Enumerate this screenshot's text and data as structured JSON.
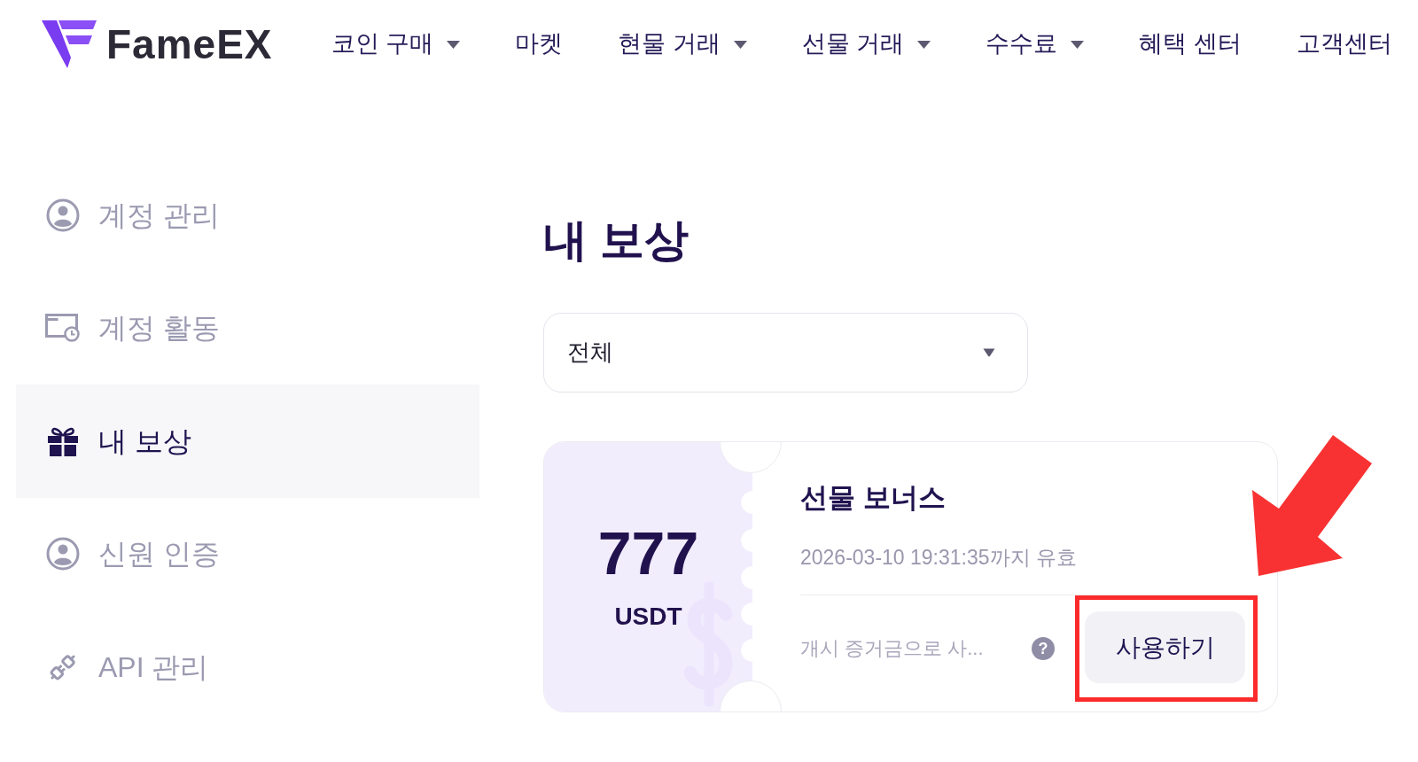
{
  "header": {
    "logo": "FameEX",
    "nav": [
      {
        "label": "코인 구매",
        "dropdown": true
      },
      {
        "label": "마켓",
        "dropdown": false
      },
      {
        "label": "현물 거래",
        "dropdown": true
      },
      {
        "label": "선물 거래",
        "dropdown": true
      },
      {
        "label": "수수료",
        "dropdown": true
      },
      {
        "label": "혜택 센터",
        "dropdown": false
      },
      {
        "label": "고객센터",
        "dropdown": false
      }
    ]
  },
  "sidebar": {
    "items": [
      {
        "label": "계정 관리",
        "selected": false
      },
      {
        "label": "계정 활동",
        "selected": false
      },
      {
        "label": "내 보상",
        "selected": true
      },
      {
        "label": "신원 인증",
        "selected": false
      },
      {
        "label": "API 관리",
        "selected": false
      }
    ]
  },
  "main": {
    "title": "내 보상",
    "filter": {
      "value": "전체"
    },
    "coupons": [
      {
        "amount": "777",
        "currency": "USDT",
        "title": "선물 보너스",
        "expiry": "2026-03-10 19:31:35까지 유효",
        "usage_note": "개시 증거금으로 사...",
        "help": "?",
        "button": {
          "label": "사용하기",
          "highlighted": true
        }
      }
    ]
  }
}
